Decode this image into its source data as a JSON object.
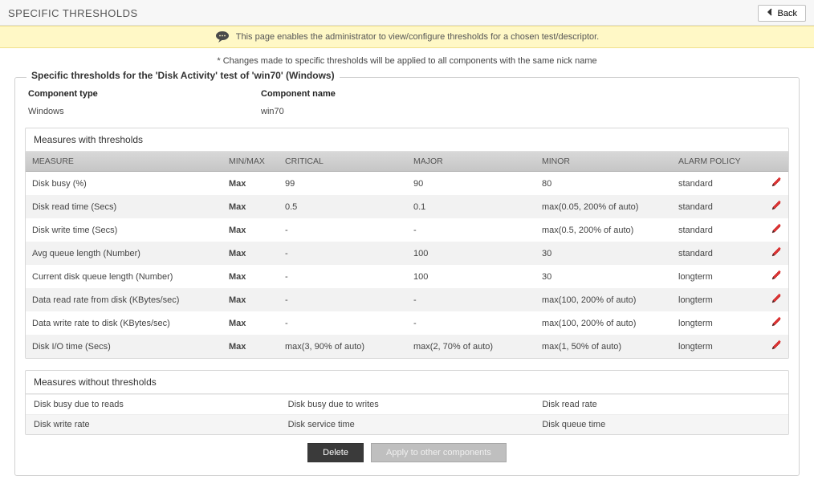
{
  "header": {
    "title": "SPECIFIC THRESHOLDS",
    "back_label": "Back"
  },
  "banner": {
    "text": "This page enables the administrator to view/configure thresholds for a chosen test/descriptor."
  },
  "changes_note": "* Changes made to specific thresholds will be applied to all components with the same nick name",
  "panel": {
    "legend": "Specific thresholds for the 'Disk Activity' test of 'win70' (Windows)",
    "component_type_label": "Component type",
    "component_type_value": "Windows",
    "component_name_label": "Component name",
    "component_name_value": "win70"
  },
  "thresholds_section": {
    "title": "Measures with thresholds",
    "columns": {
      "measure": "MEASURE",
      "minmax": "MIN/MAX",
      "critical": "CRITICAL",
      "major": "MAJOR",
      "minor": "MINOR",
      "policy": "ALARM POLICY"
    },
    "rows": [
      {
        "measure": "Disk busy (%)",
        "minmax": "Max",
        "critical": "99",
        "major": "90",
        "minor": "80",
        "policy": "standard"
      },
      {
        "measure": "Disk read time (Secs)",
        "minmax": "Max",
        "critical": "0.5",
        "major": "0.1",
        "minor": "max(0.05, 200% of auto)",
        "policy": "standard"
      },
      {
        "measure": "Disk write time (Secs)",
        "minmax": "Max",
        "critical": "-",
        "major": "-",
        "minor": "max(0.5, 200% of auto)",
        "policy": "standard"
      },
      {
        "measure": "Avg queue length (Number)",
        "minmax": "Max",
        "critical": "-",
        "major": "100",
        "minor": "30",
        "policy": "standard"
      },
      {
        "measure": "Current disk queue length (Number)",
        "minmax": "Max",
        "critical": "-",
        "major": "100",
        "minor": "30",
        "policy": "longterm"
      },
      {
        "measure": "Data read rate from disk (KBytes/sec)",
        "minmax": "Max",
        "critical": "-",
        "major": "-",
        "minor": "max(100, 200% of auto)",
        "policy": "longterm"
      },
      {
        "measure": "Data write rate to disk (KBytes/sec)",
        "minmax": "Max",
        "critical": "-",
        "major": "-",
        "minor": "max(100, 200% of auto)",
        "policy": "longterm"
      },
      {
        "measure": "Disk I/O time (Secs)",
        "minmax": "Max",
        "critical": "max(3, 90% of auto)",
        "major": "max(2, 70% of auto)",
        "minor": "max(1, 50% of auto)",
        "policy": "longterm"
      }
    ]
  },
  "no_thresholds_section": {
    "title": "Measures without thresholds",
    "rows": [
      [
        "Disk busy due to reads",
        "Disk busy due to writes",
        "Disk read rate"
      ],
      [
        "Disk write rate",
        "Disk service time",
        "Disk queue time"
      ]
    ]
  },
  "buttons": {
    "delete": "Delete",
    "apply": "Apply to other components"
  }
}
